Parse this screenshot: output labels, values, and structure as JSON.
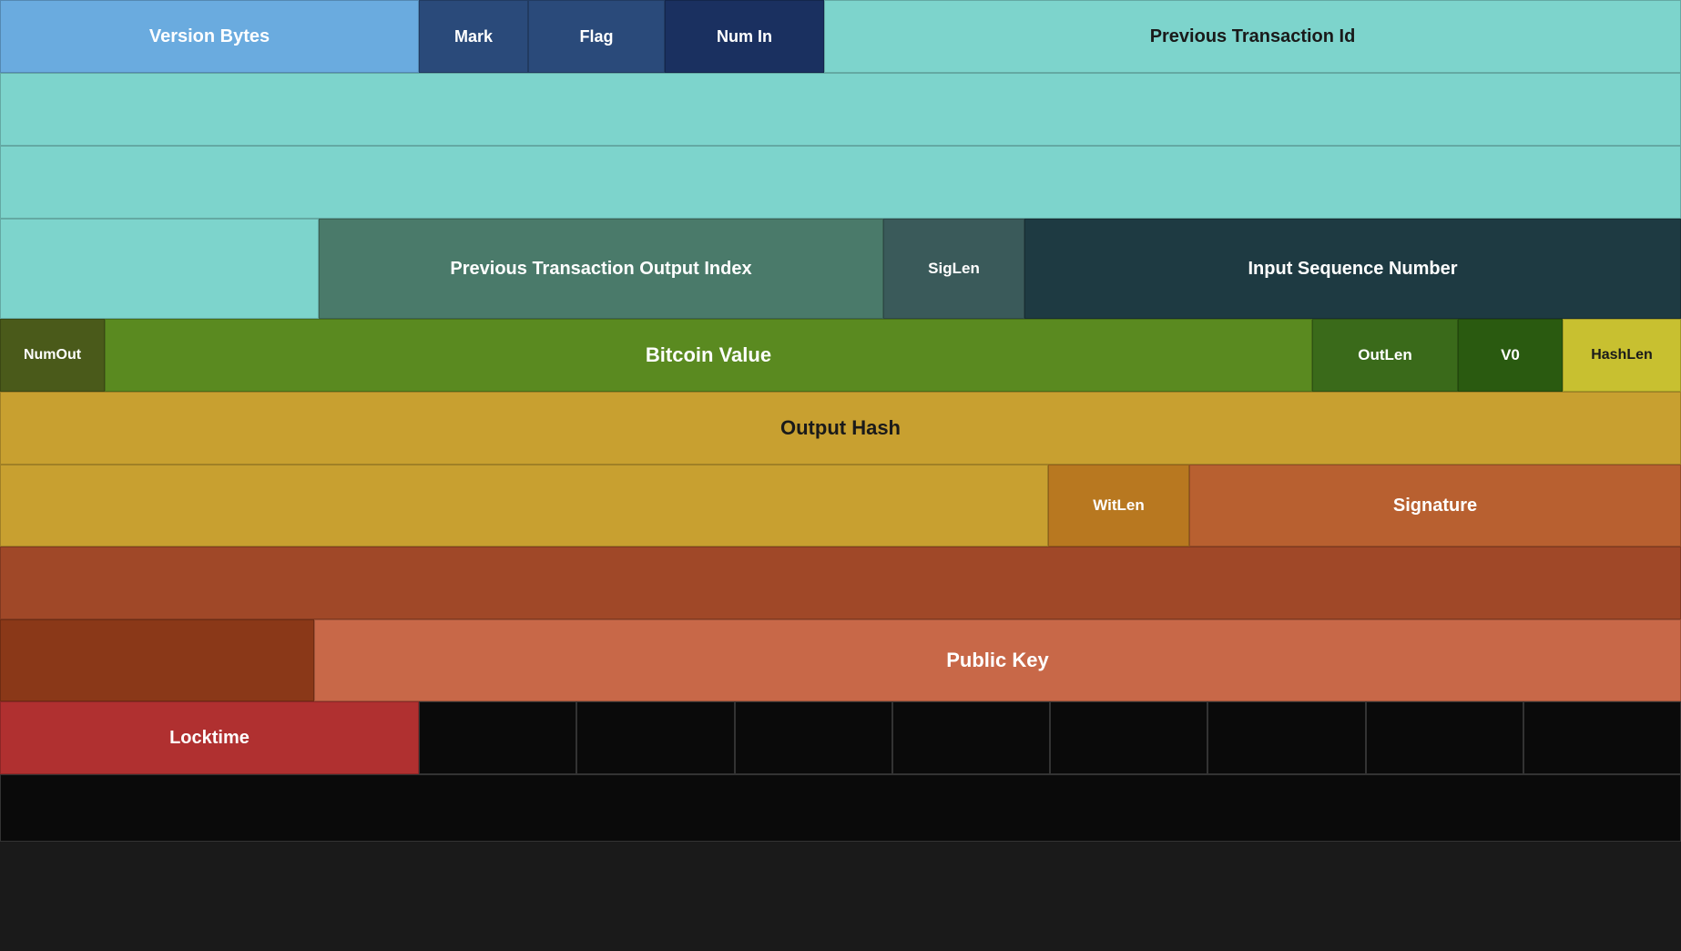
{
  "cells": {
    "version_bytes": "Version Bytes",
    "mark": "Mark",
    "flag": "Flag",
    "num_in": "Num In",
    "prev_tx_id": "Previous Transaction Id",
    "prev_tx_output_index": "Previous Transaction Output Index",
    "siglen": "SigLen",
    "input_seq_num": "Input Sequence Number",
    "numout": "NumOut",
    "bitcoin_value": "Bitcoin Value",
    "outlen": "OutLen",
    "v0": "V0",
    "hashlen": "HashLen",
    "output_hash": "Output Hash",
    "witlen": "WitLen",
    "signature": "Signature",
    "public_key": "Public Key",
    "locktime": "Locktime"
  }
}
